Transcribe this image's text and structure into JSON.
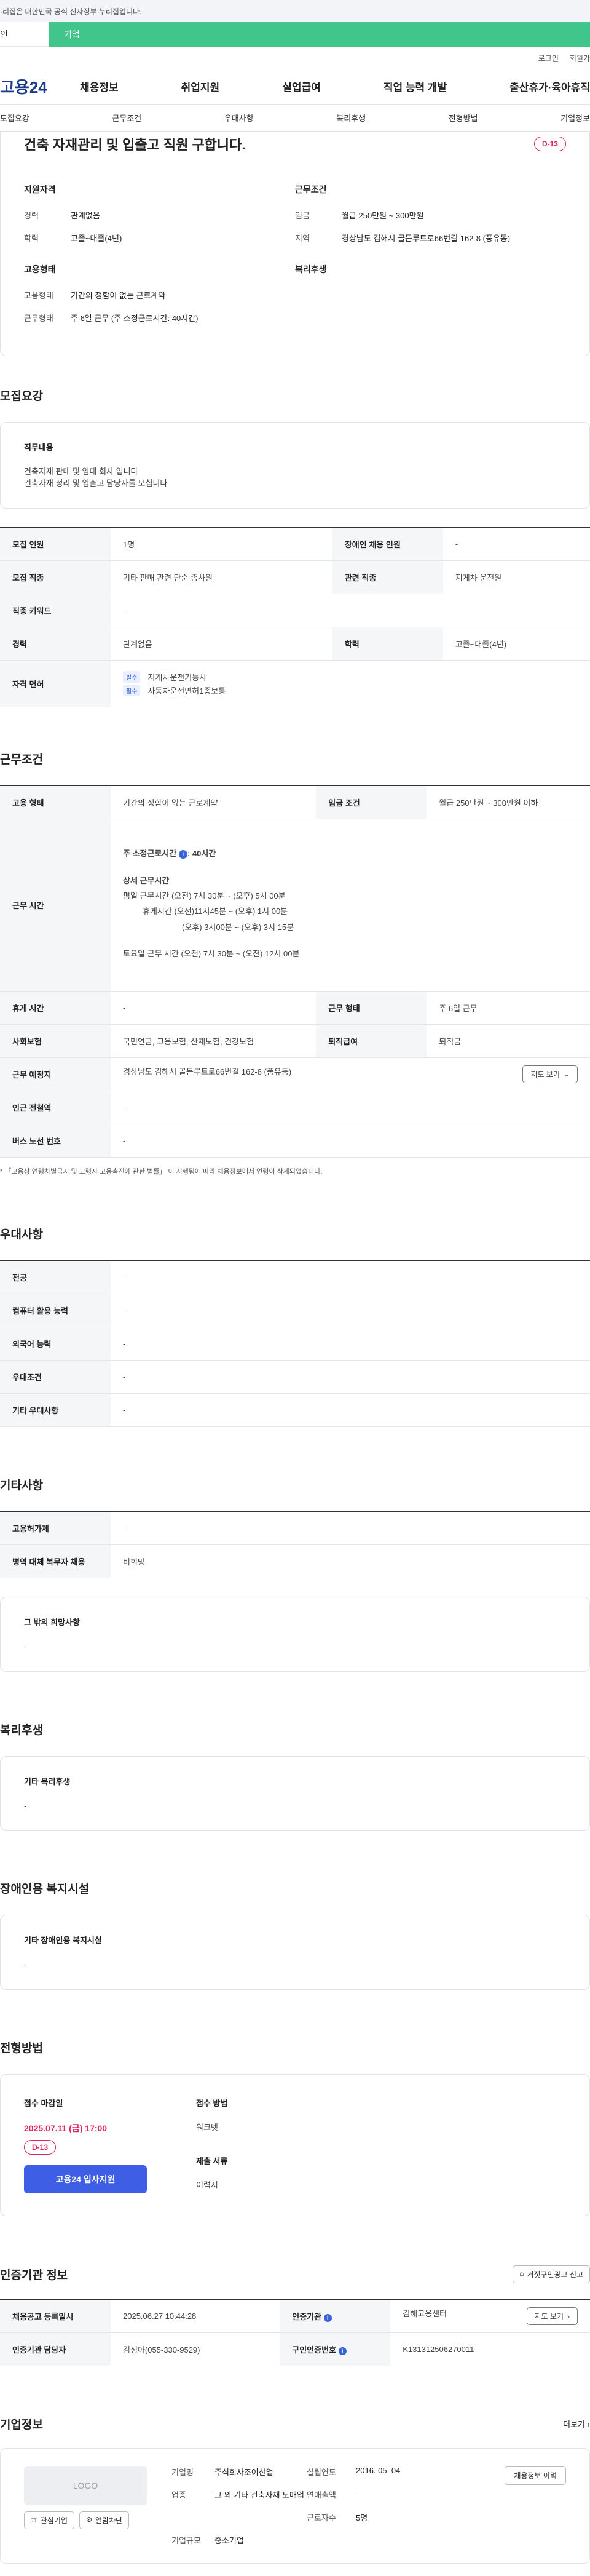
{
  "top_notice": "·리집은 대한민국 공식 전자정부 누리집입니다.",
  "service_tabs": [
    "인",
    "기업"
  ],
  "util_links": [
    "로그인",
    "회원가"
  ],
  "logo": "고용24",
  "gnb": [
    "채용정보",
    "취업지원",
    "실업급여",
    "직업 능력 개발",
    "출산휴가·육아휴직"
  ],
  "anchor_tabs": [
    "모집요강",
    "근무조건",
    "우대사항",
    "복리후생",
    "전형방법",
    "기업정보"
  ],
  "summary": {
    "title": "건축 자재관리 및 입출고 직원 구합니다.",
    "dday": "D-13",
    "qual_h": "지원자격",
    "career_k": "경력",
    "career_v": "관계없음",
    "edu_k": "학력",
    "edu_v": "고졸~대졸(4년)",
    "emp_h": "고용형태",
    "emptype_k": "고용형태",
    "emptype_v": "기간의 정함이 없는 근로계약",
    "workform_k": "근무형태",
    "workform_v": "주 6일 근무 (주 소정근로시간: 40시간)",
    "cond_h": "근무조건",
    "wage_k": "임금",
    "wage_v": "월급 250만원 ~ 300만원",
    "region_k": "지역",
    "region_v": "경상남도 김해시 골든루트로66번길 162-8 (풍유동)",
    "welfare_h": "복리후생"
  },
  "recruit": {
    "title": "모집요강",
    "duty_h": "직무내용",
    "duty_1": "건축자재 판매 및 임대 회사 입니다",
    "duty_2": "건축자재 정리 및 입출고 담당자를 모십니다",
    "rows": [
      {
        "k1": "모집 인원",
        "v1": "1명",
        "k2": "장애인 채용 인원",
        "v2": "-"
      },
      {
        "k1": "모집 직종",
        "v1": "기타 판매 관련 단순 종사원",
        "k2": "관련 직종",
        "v2": "지게차 운전원"
      },
      {
        "k1": "직종 키워드",
        "v1": "-"
      },
      {
        "k1": "경력",
        "v1": "관계없음",
        "k2": "학력",
        "v2": "고졸~대졸(4년)"
      }
    ],
    "license_k": "자격 면허",
    "license_tag": "필수",
    "license_1": "지게차운전기능사",
    "license_2": "자동차운전면허1종보통"
  },
  "work": {
    "title": "근무조건",
    "emptype_k": "고용 형태",
    "emptype_v": "기간의 정함이 없는 근로계약",
    "wage_k": "임금 조건",
    "wage_v": "월급 250만원 ~ 300만원 이하",
    "time_k": "근무 시간",
    "std_label": "주 소정근로시간",
    "std_value": ": 40시간",
    "detail_h": "상세 근무시간",
    "line_1": "평일 근무시간  (오전) 7시 30분 ~ (오후) 5시 00분",
    "line_2": "휴게시간  (오전)11시45분 ~ (오후) 1시 00분",
    "line_3": "(오후)  3시00분 ~ (오후) 3시 15분",
    "line_4": "토요일 근무 시간 (오전) 7시 30분 ~ (오전) 12시 00분",
    "holiday_k": "휴게 시간",
    "holiday_v": "-",
    "form_k": "근무 형태",
    "form_v": "주 6일 근무",
    "ins_k": "사회보험",
    "ins_v": "국민연금, 고용보험, 산재보험, 건강보험",
    "sev_k": "퇴직급여",
    "sev_v": "퇴직금",
    "place_k": "근무 예정지",
    "place_v": "경상남도 김해시 골든루트로66번길 162-8 (풍유동)",
    "map_btn": "지도 보기",
    "subway_k": "인근 전철역",
    "subway_v": "-",
    "bus_k": "버스 노선 번호",
    "bus_v": "-",
    "note": "* 「고용상 연령차별금지 및 고령자 고용촉진에 관한 법률」 이 시행됨에 따라 채용정보에서 연령이 삭제되었습니다."
  },
  "pref": {
    "title": "우대사항",
    "rows": [
      {
        "k": "전공",
        "v": "-"
      },
      {
        "k": "컴퓨터 활용 능력",
        "v": "-"
      },
      {
        "k": "외국어 능력",
        "v": "-"
      },
      {
        "k": "우대조건",
        "v": "-"
      },
      {
        "k": "기타 우대사항",
        "v": "-"
      }
    ]
  },
  "etc": {
    "title": "기타사항",
    "rows": [
      {
        "k": "고용허가제",
        "v": "-"
      },
      {
        "k": "병역 대체 복무자 채용",
        "v": "비희망"
      }
    ],
    "wish_h": "그 밖의 희망사항",
    "wish_v": "-"
  },
  "welfare": {
    "title": "복리후생",
    "h": "기타 복리후생",
    "v": "-"
  },
  "disabled": {
    "title": "장애인용 복지시설",
    "h": "기타 장애인용 복지시설",
    "v": "-"
  },
  "apply": {
    "title": "전형방법",
    "deadline_h": "접수 마감일",
    "deadline_v": "2025.07.11 (금) 17:00",
    "dday": "D-13",
    "btn": "고용24 입사지원",
    "method_h": "접수 방법",
    "method_v": "워크넷",
    "docs_h": "제출 서류",
    "docs_v": "이력서"
  },
  "cert": {
    "title": "인증기관 정보",
    "report_btn": "거짓구인광고 신고",
    "reg_k": "채용공고 등록일시",
    "reg_v": "2025.06.27 10:44:28",
    "org_k": "인증기관",
    "org_v": "김해고용센터",
    "map_btn": "지도 보기",
    "mgr_k": "인증기관 담당자",
    "mgr_v": "김정아(055-330-9529)",
    "no_k": "구인인증번호",
    "no_v": "K131312506270011"
  },
  "corp": {
    "title": "기업정보",
    "more": "더보기",
    "logo": "LOGO",
    "fav": "관심기업",
    "block": "열람차단",
    "name_k": "기업명",
    "name_v": "주식회사조이산업",
    "year_k": "설립연도",
    "year_v": "2016. 05. 04",
    "ind_k": "업종",
    "ind_v": "그 외 기타 건축자재 도매업",
    "sales_k": "연매출액",
    "sales_v": "-",
    "emp_k": "근로자수",
    "emp_v": "5명",
    "size_k": "기업규모",
    "size_v": "중소기업",
    "history_btn": "채용정보 이력"
  }
}
